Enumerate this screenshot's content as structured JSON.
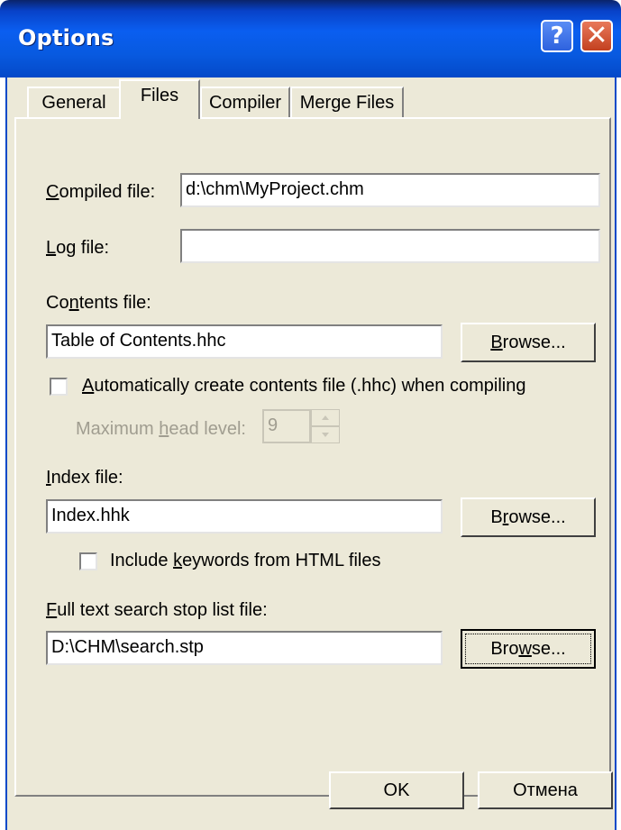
{
  "window": {
    "title": "Options",
    "help_glyph": "?",
    "close_glyph": "✕"
  },
  "tabs": [
    {
      "label": "General",
      "active": false
    },
    {
      "label": "Files",
      "active": true
    },
    {
      "label": "Compiler",
      "active": false
    },
    {
      "label": "Merge Files",
      "active": false
    }
  ],
  "files": {
    "compiled_file": {
      "access_key": "C",
      "label_rest": "ompiled file:",
      "value": "d:\\chm\\MyProject.chm"
    },
    "log_file": {
      "access_key": "L",
      "label_rest": "og file:",
      "value": ""
    },
    "contents_file": {
      "label_pre": "Co",
      "access_key": "n",
      "label_post": "tents file:",
      "value": "Table of Contents.hhc",
      "browse": {
        "access_key": "B",
        "label_rest": "rowse..."
      }
    },
    "auto_contents": {
      "access_key": "A",
      "label_rest": "utomatically create contents file (.hhc) when compiling",
      "checked": false
    },
    "max_head_level": {
      "label_pre": "Maximum ",
      "access_key": "h",
      "label_post": "ead level:",
      "value": "9",
      "disabled": true
    },
    "index_file": {
      "access_key": "I",
      "label_rest": "ndex file:",
      "value": "Index.hhk",
      "browse": {
        "label_pre": "B",
        "access_key": "r",
        "label_post": "owse..."
      }
    },
    "include_keywords": {
      "label_pre": "Include ",
      "access_key": "k",
      "label_post": "eywords from HTML files",
      "checked": false
    },
    "stop_list_file": {
      "access_key": "F",
      "label_rest": "ull text search stop list file:",
      "value": "D:\\CHM\\search.stp",
      "browse": {
        "label_pre": "Bro",
        "access_key": "w",
        "label_post": "se..."
      }
    }
  },
  "footer": {
    "ok_label": "OK",
    "cancel_label": "Отмена"
  }
}
